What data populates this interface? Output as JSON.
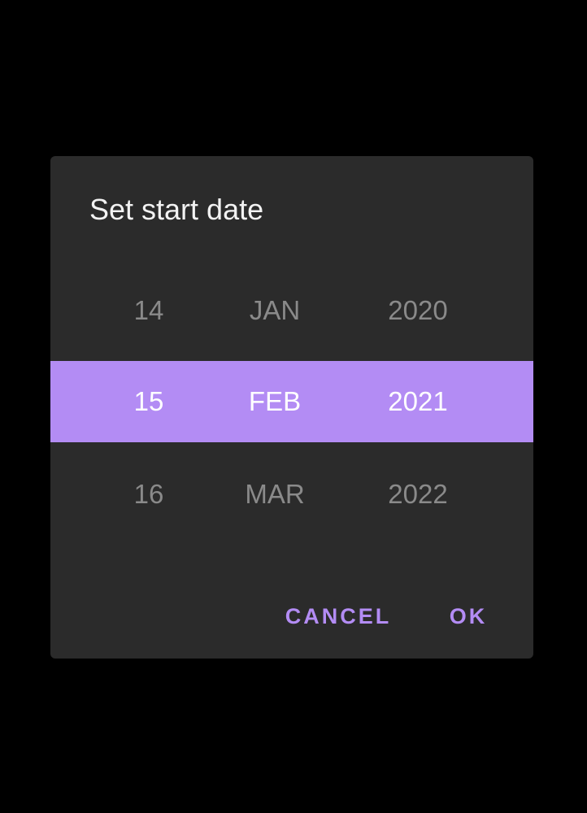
{
  "dialog": {
    "title": "Set start date"
  },
  "picker": {
    "rows": [
      {
        "day": "14",
        "month": "JAN",
        "year": "2020"
      },
      {
        "day": "15",
        "month": "FEB",
        "year": "2021"
      },
      {
        "day": "16",
        "month": "MAR",
        "year": "2022"
      }
    ],
    "selected_index": 1
  },
  "actions": {
    "cancel_label": "CANCEL",
    "ok_label": "OK"
  },
  "colors": {
    "background": "#000000",
    "dialog_surface": "#2b2b2b",
    "accent": "#b38cf4",
    "title_text": "#f2f2f2",
    "muted_text": "#8a8a8a"
  }
}
